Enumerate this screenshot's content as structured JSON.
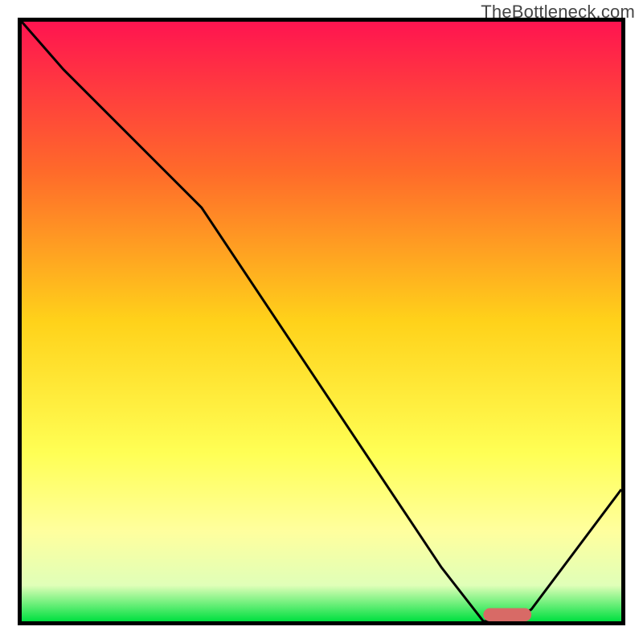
{
  "watermark": "TheBottleneck.com",
  "chart_data": {
    "type": "line",
    "title": "",
    "xlabel": "",
    "ylabel": "",
    "xlim": [
      0,
      100
    ],
    "ylim": [
      0,
      100
    ],
    "grid": false,
    "legend": false,
    "background": "heatmap-gradient-vertical",
    "gradient_colors": [
      {
        "stop": 0.0,
        "color": "#ff1450"
      },
      {
        "stop": 0.25,
        "color": "#ff6a2a"
      },
      {
        "stop": 0.5,
        "color": "#ffd21a"
      },
      {
        "stop": 0.72,
        "color": "#ffff55"
      },
      {
        "stop": 0.85,
        "color": "#ffff9e"
      },
      {
        "stop": 0.94,
        "color": "#e0ffb8"
      },
      {
        "stop": 1.0,
        "color": "#00e040"
      }
    ],
    "series": [
      {
        "name": "curve",
        "stroke": "#000000",
        "stroke_width": 3,
        "x": [
          0,
          7,
          24,
          30,
          70,
          77,
          82,
          85,
          100
        ],
        "y": [
          100,
          92,
          75,
          69,
          9,
          0,
          0,
          2,
          22
        ]
      }
    ],
    "markers": [
      {
        "name": "highlight-segment",
        "shape": "rounded-bar",
        "color": "#d86a66",
        "x_start": 77,
        "x_end": 85,
        "y": 0,
        "height_pct": 2.2
      }
    ],
    "axes": {
      "border_color": "#000000",
      "border_width": 5
    }
  }
}
